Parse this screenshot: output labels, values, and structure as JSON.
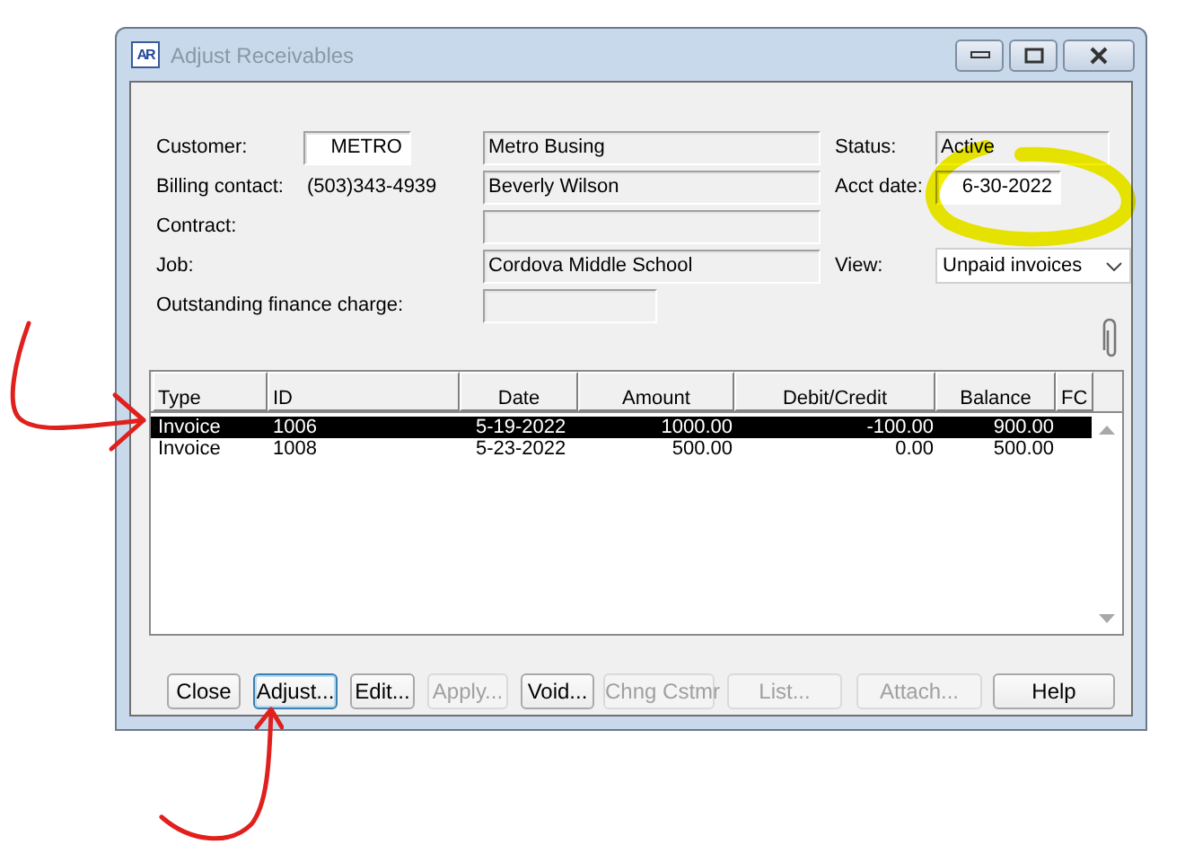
{
  "window": {
    "title": "Adjust Receivables",
    "icon_text": "AR"
  },
  "form": {
    "customer": {
      "label": "Customer:",
      "code": "METRO",
      "name": "Metro Busing"
    },
    "status": {
      "label": "Status:",
      "value": "Active"
    },
    "billing_contact": {
      "label": "Billing contact:",
      "phone": "(503)343-4939",
      "name": "Beverly Wilson"
    },
    "acct_date": {
      "label": "Acct date:",
      "value": "6-30-2022"
    },
    "contract": {
      "label": "Contract:"
    },
    "job": {
      "label": "Job:",
      "value": "Cordova Middle School"
    },
    "view": {
      "label": "View:",
      "value": "Unpaid invoices"
    },
    "finance_charge": {
      "label": "Outstanding finance charge:"
    }
  },
  "table": {
    "columns": [
      "Type",
      "ID",
      "Date",
      "Amount",
      "Debit/Credit",
      "Balance",
      "FC"
    ],
    "rows": [
      {
        "cells": [
          "Invoice",
          "1006",
          "5-19-2022",
          "1000.00",
          "-100.00",
          "900.00"
        ],
        "selected": true
      },
      {
        "cells": [
          "Invoice",
          "1008",
          "5-23-2022",
          "500.00",
          "0.00",
          "500.00"
        ],
        "selected": false
      }
    ]
  },
  "buttons": [
    {
      "label": "Close",
      "disabled": false,
      "focused": false
    },
    {
      "label": "Adjust...",
      "disabled": false,
      "focused": true
    },
    {
      "label": "Edit...",
      "disabled": false,
      "focused": false
    },
    {
      "label": "Apply...",
      "disabled": true,
      "focused": false
    },
    {
      "label": "Void...",
      "disabled": false,
      "focused": false
    },
    {
      "label": "Chng Cstmr",
      "disabled": true,
      "focused": false
    },
    {
      "label": "List...",
      "disabled": true,
      "focused": false
    },
    {
      "label": "Attach...",
      "disabled": true,
      "focused": false
    },
    {
      "label": "Help",
      "disabled": false,
      "focused": false
    }
  ]
}
